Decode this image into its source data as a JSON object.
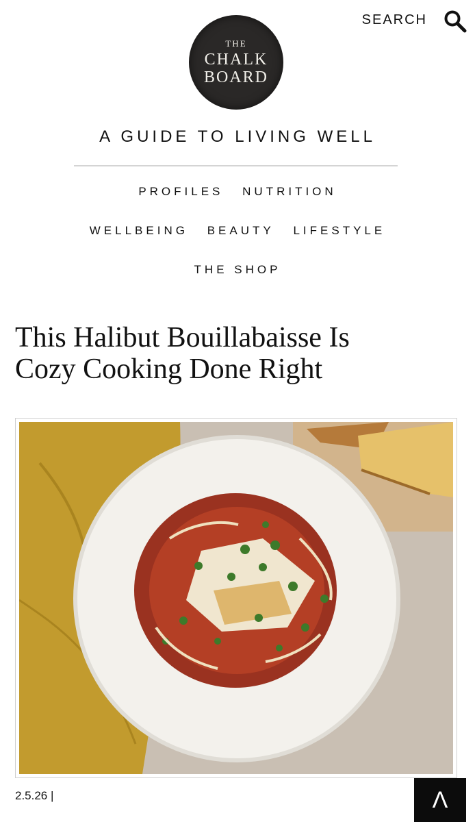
{
  "header": {
    "search_label": "SEARCH",
    "search_icon": "search-icon",
    "logo": {
      "line1": "THE",
      "line2": "CHALK",
      "line3": "BOARD"
    },
    "tagline": "A GUIDE TO LIVING WELL"
  },
  "nav": {
    "row1": [
      "PROFILES",
      "NUTRITION"
    ],
    "row2": [
      "WELLBEING",
      "BEAUTY",
      "LIFESTYLE"
    ],
    "row3": [
      "THE SHOP"
    ]
  },
  "article": {
    "title_line1": "This Halibut Bouillabaisse Is",
    "title_line2": "Cozy Cooking Done Right",
    "date": "2.5.26  |"
  },
  "back_to_top": {
    "glyph": "Λ",
    "icon": "chevron-up-icon"
  },
  "colors": {
    "text": "#111111",
    "rule": "#d4d4d4",
    "logo_bg": "#2a2827",
    "button_bg": "#0c0c0c"
  }
}
